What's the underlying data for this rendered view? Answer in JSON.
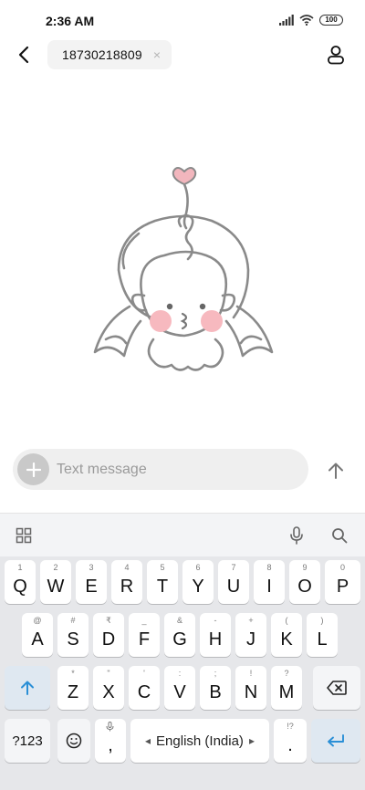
{
  "status_bar": {
    "time": "2:36 AM",
    "battery": "100"
  },
  "header": {
    "recipient_number": "18730218809",
    "chip_close": "×"
  },
  "compose": {
    "placeholder": "Text message"
  },
  "keyboard": {
    "row1": [
      {
        "hint": "1",
        "label": "Q"
      },
      {
        "hint": "2",
        "label": "W"
      },
      {
        "hint": "3",
        "label": "E"
      },
      {
        "hint": "4",
        "label": "R"
      },
      {
        "hint": "5",
        "label": "T"
      },
      {
        "hint": "6",
        "label": "Y"
      },
      {
        "hint": "7",
        "label": "U"
      },
      {
        "hint": "8",
        "label": "I"
      },
      {
        "hint": "9",
        "label": "O"
      },
      {
        "hint": "0",
        "label": "P"
      }
    ],
    "row2": [
      {
        "hint": "@",
        "label": "A"
      },
      {
        "hint": "#",
        "label": "S"
      },
      {
        "hint": "₹",
        "label": "D"
      },
      {
        "hint": "_",
        "label": "F"
      },
      {
        "hint": "&",
        "label": "G"
      },
      {
        "hint": "-",
        "label": "H"
      },
      {
        "hint": "+",
        "label": "J"
      },
      {
        "hint": "(",
        "label": "K"
      },
      {
        "hint": ")",
        "label": "L"
      }
    ],
    "row3": [
      {
        "hint": "*",
        "label": "Z"
      },
      {
        "hint": "\"",
        "label": "X"
      },
      {
        "hint": "'",
        "label": "C"
      },
      {
        "hint": ":",
        "label": "V"
      },
      {
        "hint": ";",
        "label": "B"
      },
      {
        "hint": "!",
        "label": "N"
      },
      {
        "hint": "?",
        "label": "M"
      }
    ],
    "symbols_key": "?123",
    "comma": ",",
    "period": ".",
    "period_hint": "!?",
    "space_label": "English (India)",
    "space_left_arrow": "◂",
    "space_right_arrow": "▸"
  }
}
